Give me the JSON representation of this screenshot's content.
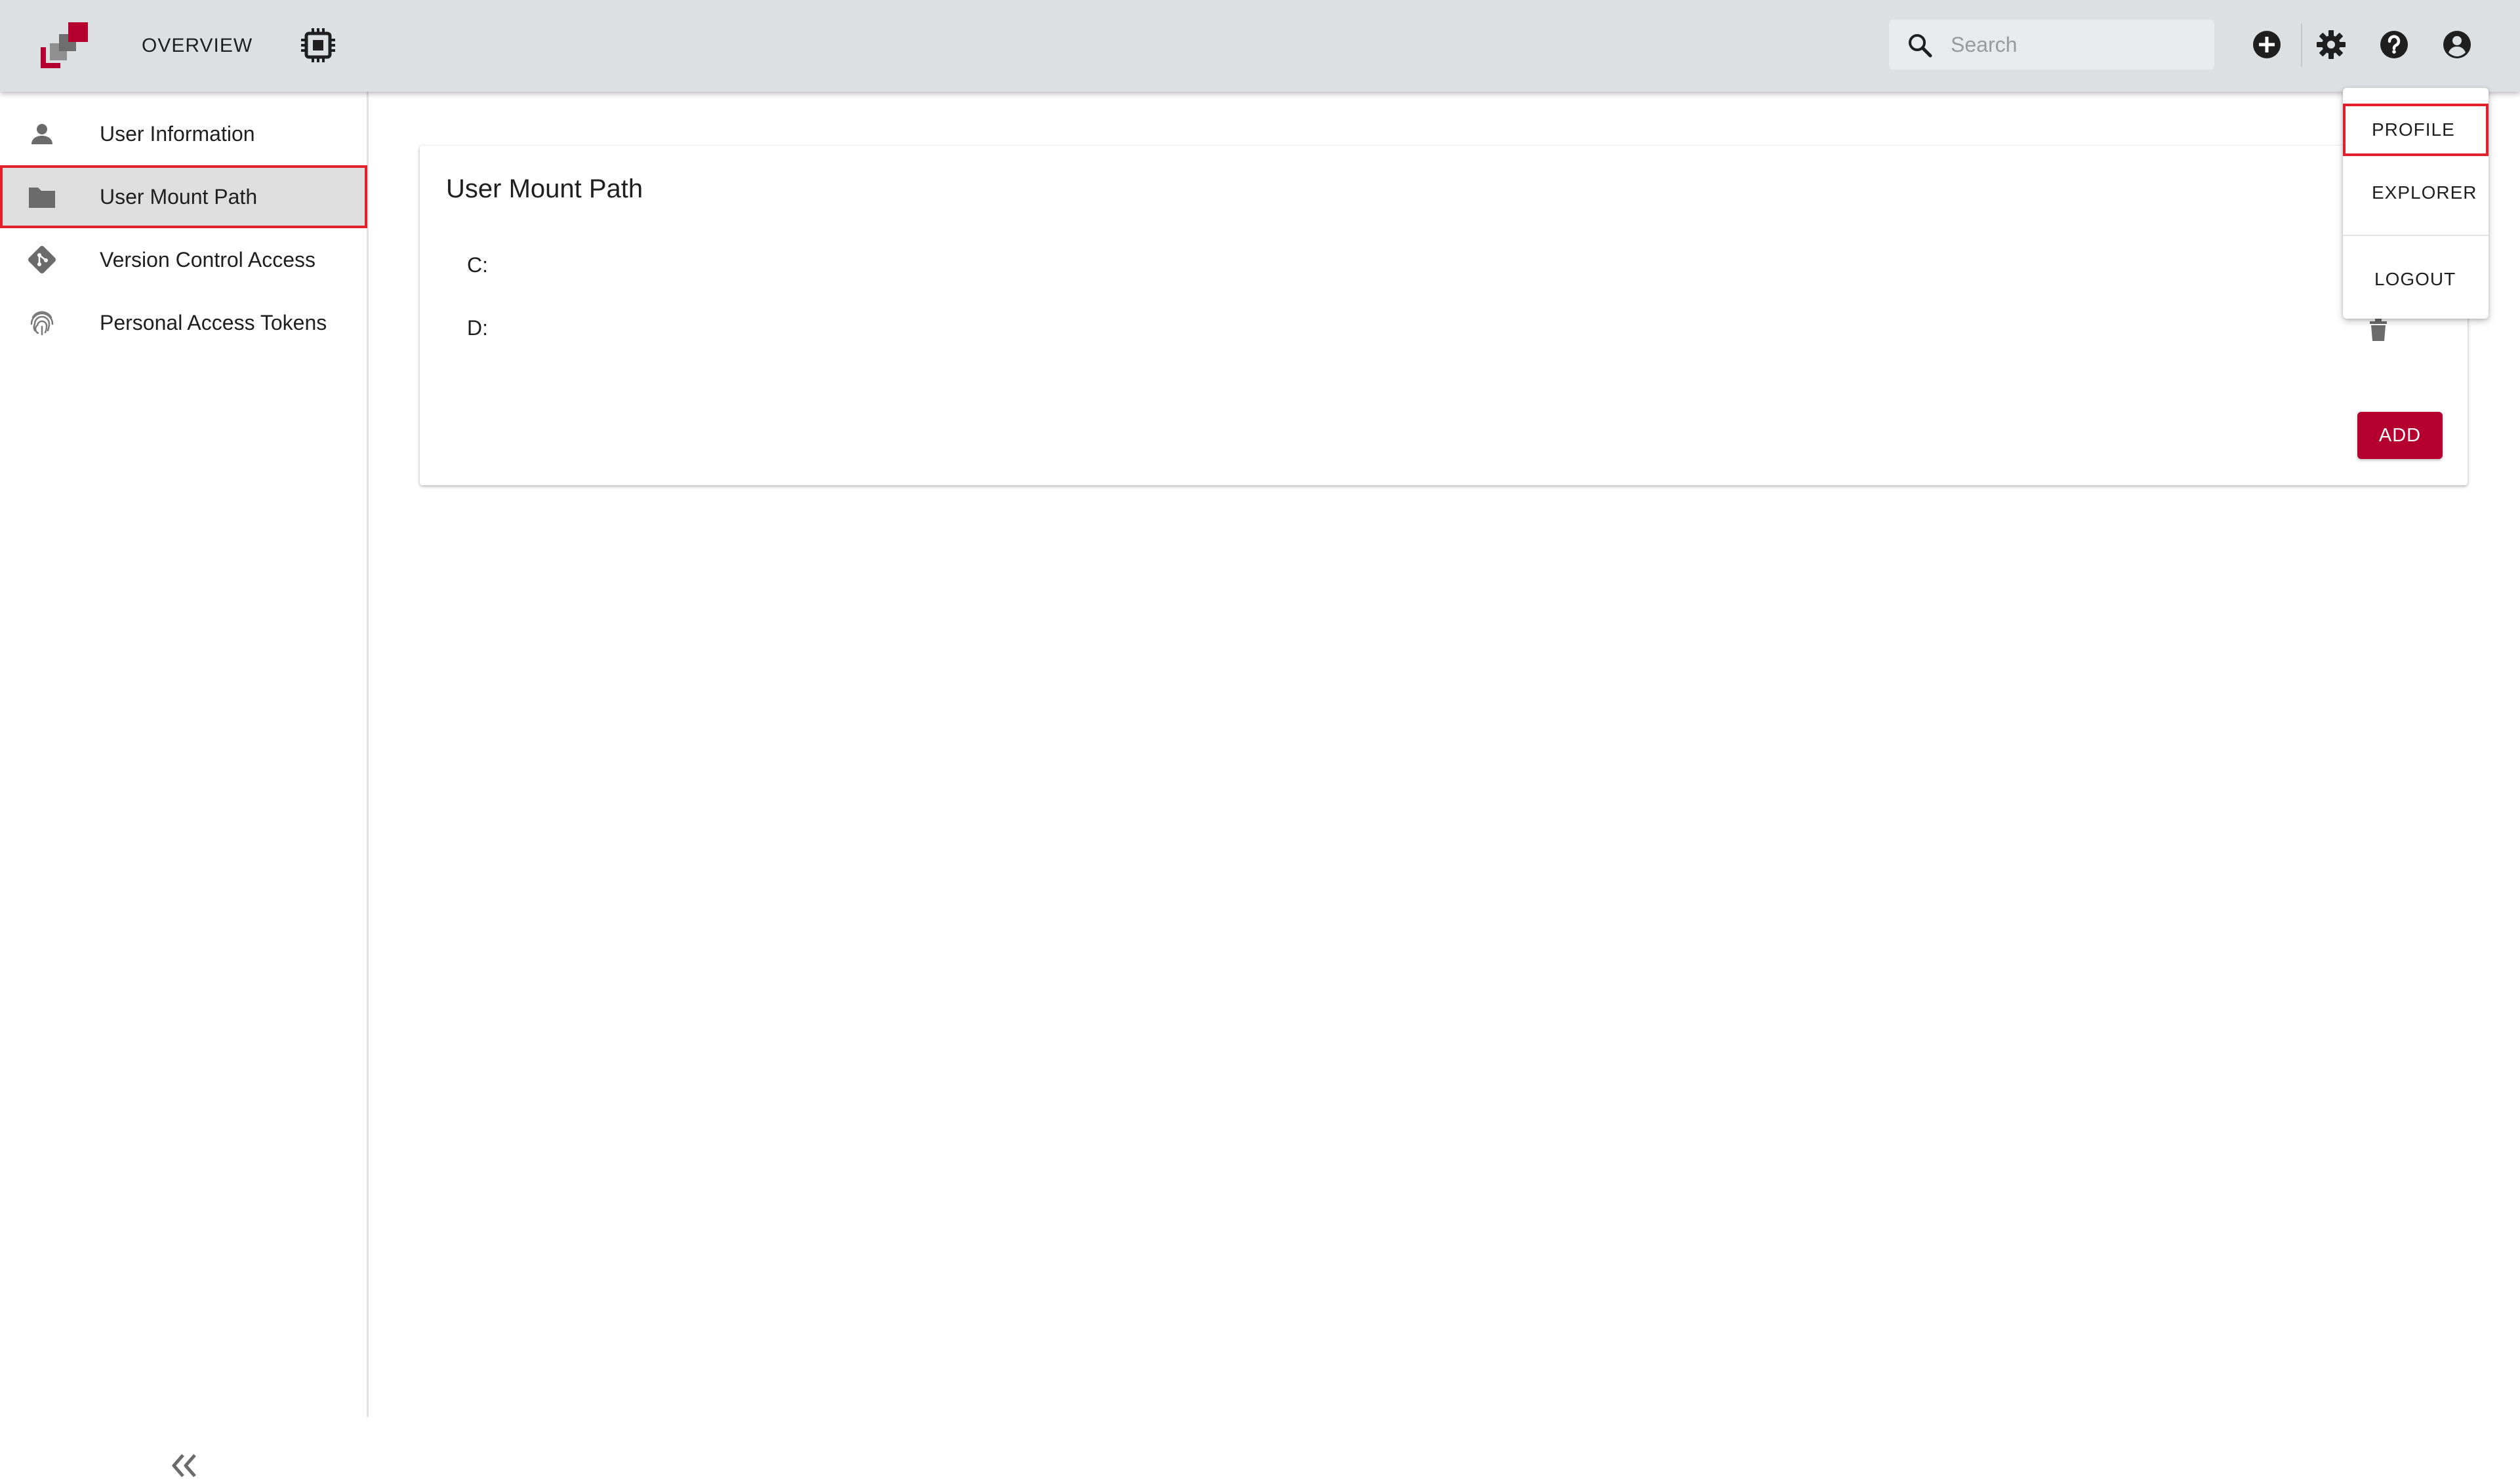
{
  "topbar": {
    "nav_overview_label": "OVERVIEW",
    "search_placeholder": "Search",
    "icons": [
      "app-logo",
      "chip-icon",
      "search-icon",
      "add-circle-icon",
      "gear-icon",
      "help-icon",
      "account-icon"
    ]
  },
  "sidebar": {
    "items": [
      {
        "label": "User Information",
        "icon": "person-icon"
      },
      {
        "label": "User Mount Path",
        "icon": "folder-icon"
      },
      {
        "label": "Version Control Access",
        "icon": "git-icon"
      },
      {
        "label": "Personal Access Tokens",
        "icon": "fingerprint-icon"
      }
    ],
    "active_item": "User Mount Path",
    "collapse_icon": "double-chevron-left-icon"
  },
  "card": {
    "title": "User Mount Path",
    "drives": [
      "C:",
      "D:"
    ],
    "add_label": "ADD"
  },
  "user_menu": {
    "items": [
      "PROFILE",
      "EXPLORER",
      "LOGOUT"
    ],
    "highlighted": "PROFILE"
  },
  "colors": {
    "accent": "#b5002f",
    "topbar_bg": "#dde0e3",
    "highlight_outline": "#e0202a",
    "active_item_bg": "#dedede"
  }
}
